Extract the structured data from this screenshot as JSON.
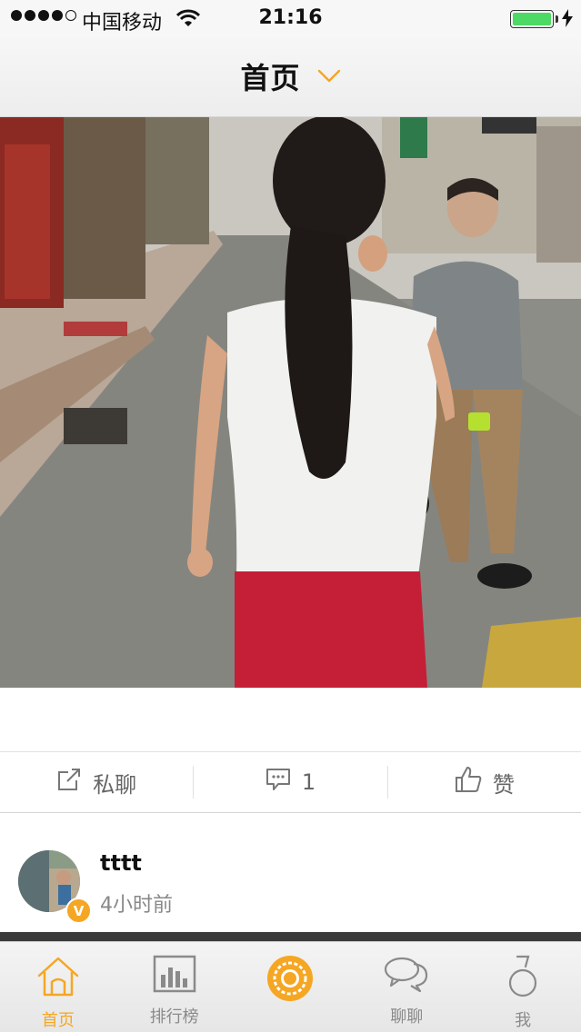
{
  "status_bar": {
    "carrier": "中国移动",
    "time": "21:16",
    "signal_bars": 4,
    "battery_level": 1.0
  },
  "nav": {
    "title": "首页"
  },
  "actions": {
    "chat_label": "私聊",
    "comment_count": "1",
    "like_label": "赞"
  },
  "author": {
    "username": "tttt",
    "time_ago": "4小时前",
    "verified_badge": "V"
  },
  "tabs": [
    {
      "label": "首页",
      "icon": "home-icon",
      "active": true
    },
    {
      "label": "排行榜",
      "icon": "bar-chart-icon",
      "active": false
    },
    {
      "label": "",
      "icon": "camera-shutter-icon",
      "active": false
    },
    {
      "label": "聊聊",
      "icon": "chat-bubbles-icon",
      "active": false
    },
    {
      "label": "我",
      "icon": "person-icon",
      "active": false
    }
  ],
  "colors": {
    "accent": "#f5a623",
    "battery": "#4cd964"
  }
}
